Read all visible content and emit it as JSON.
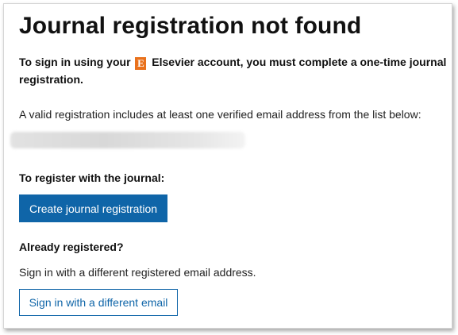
{
  "page": {
    "title": "Journal registration not found"
  },
  "intro": {
    "before_logo": "To sign in using your ",
    "logo_letter": "E",
    "after_logo": " Elsevier account, you must complete a one-time journal registration."
  },
  "valid_text": "A valid registration includes at least one verified email address from the list below:",
  "register": {
    "heading": "To register with the journal:",
    "button_label": "Create journal registration"
  },
  "already": {
    "heading": "Already registered?",
    "text": "Sign in with a different registered email address.",
    "button_label": "Sign in with a different email"
  },
  "colors": {
    "primary_button": "#0f65a8",
    "elsevier_orange": "#e9711c"
  },
  "icons": {
    "brand": "elsevier-logo-icon"
  }
}
